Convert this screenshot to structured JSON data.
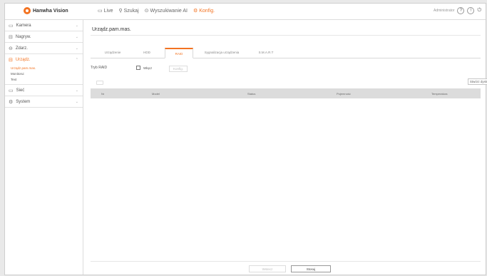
{
  "app": {
    "brand": "Hanwha Vision"
  },
  "nav": {
    "items": [
      {
        "label": "Live",
        "icon": "monitor-icon"
      },
      {
        "label": "Szukaj",
        "icon": "search-icon"
      },
      {
        "label": "Wyszukiwanie AI",
        "icon": "ai-icon"
      },
      {
        "label": "Konfig.",
        "icon": "gear-icon",
        "active": true
      }
    ],
    "user": "Administrator",
    "help_icon": "help-icon",
    "logout_icon": "logout-icon"
  },
  "sidebar": {
    "items": [
      {
        "label": "Kamera",
        "icon": "camera-icon"
      },
      {
        "label": "Nagryw.",
        "icon": "record-icon"
      },
      {
        "label": "Zdarz.",
        "icon": "event-icon"
      },
      {
        "label": "Urządz.",
        "icon": "device-icon",
        "open": true
      },
      {
        "label": "Sieć",
        "icon": "network-icon"
      },
      {
        "label": "System",
        "icon": "system-icon"
      }
    ],
    "subitems": [
      "Urządz.pam.mas.",
      "Monitorui",
      "Text"
    ]
  },
  "main": {
    "title": "Urządz.pam.mas.",
    "tabs": [
      "Urządzenie",
      "HDD",
      "RAID",
      "Sygnalizacja urządzenia",
      "S.M.A.R.T"
    ],
    "active_tab": "RAID",
    "raid_mode_label": "Tryb RAID",
    "raid_checkbox_label": "Włącz",
    "config_button": "Konfig.",
    "add_disk_button": "Stwórz dysk",
    "table_headers": [
      "Nr",
      "Model",
      "Status",
      "Pojemność",
      "Temperatura"
    ],
    "apply_button": "Stosuj",
    "cancel_button": "Wstecz",
    "accent": "#f37321"
  }
}
